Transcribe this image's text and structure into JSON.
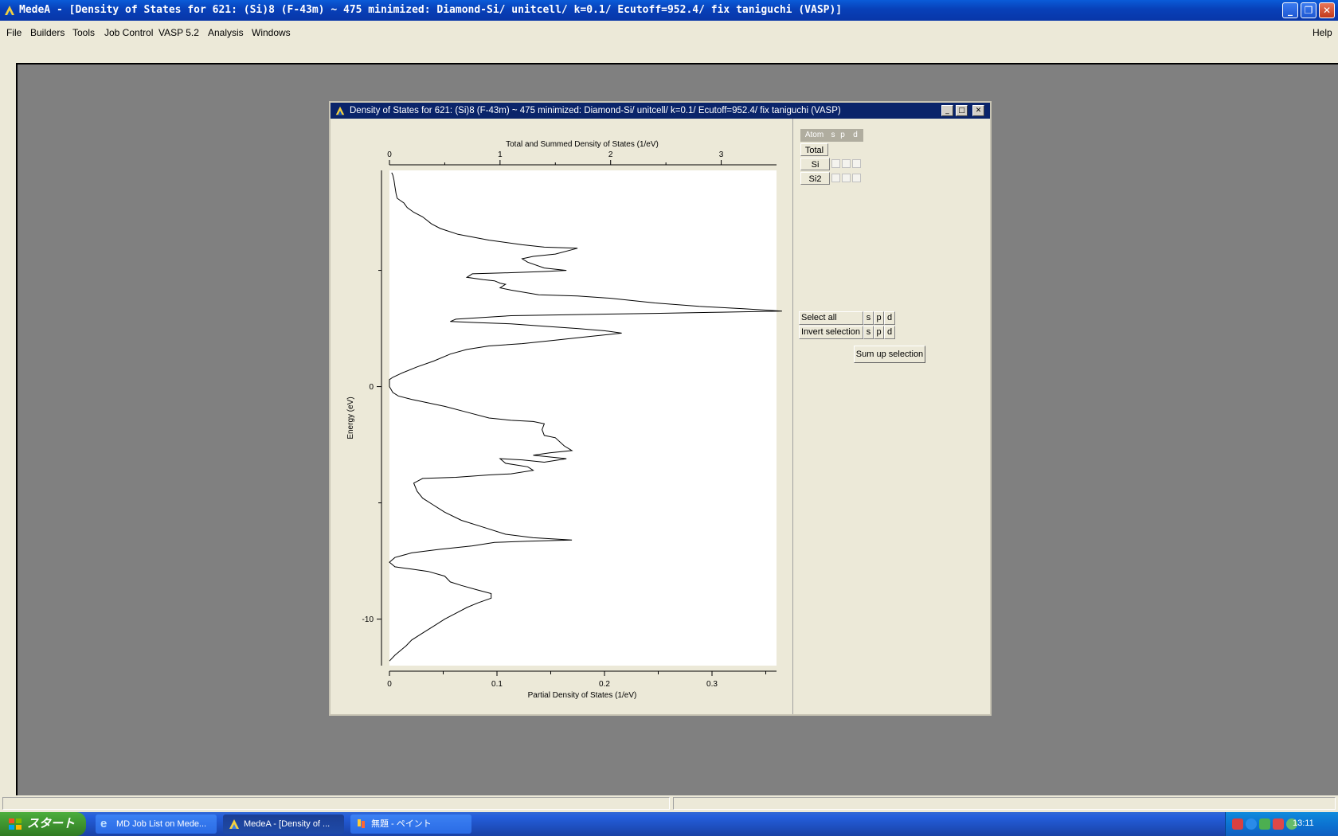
{
  "window": {
    "title": "MedeA - [Density of States for 621: (Si)8  (F-43m) ~ 475 minimized: Diamond-Si/ unitcell/ k=0.1/ Ecutoff=952.4/ fix taniguchi (VASP)]"
  },
  "menu": {
    "items": [
      "File",
      "Builders",
      "Tools",
      "Job Control",
      "VASP 5.2",
      "Analysis",
      "Windows"
    ],
    "help": "Help"
  },
  "child": {
    "title": "Density of States for 621: (Si)8  (F-43m) ~ 475 minimized: Diamond-Si/ unitcell/ k=0.1/ Ecutoff=952.4/ fix taniguchi (VASP)"
  },
  "chart_data": {
    "type": "line",
    "orientation": "vertical-energy",
    "title": "Total and Summed Density of States (1/eV)",
    "xlabel": "Partial Density of States (1/eV)",
    "ylabel": "Energy (eV)",
    "top_axis": {
      "ticks": [
        0,
        1,
        2,
        3
      ],
      "range": [
        0,
        3.5
      ]
    },
    "bottom_axis": {
      "ticks": [
        0,
        0.1,
        0.2,
        0.3
      ],
      "range": [
        0,
        0.36
      ]
    },
    "y_ticks": [
      0,
      -10
    ],
    "ylim": [
      -12,
      9.3
    ],
    "series": [
      {
        "points": [
          [
            0.02,
            9.2
          ],
          [
            0.03,
            9.1
          ],
          [
            0.04,
            8.9
          ],
          [
            0.05,
            8.6
          ],
          [
            0.06,
            8.3
          ],
          [
            0.07,
            8.1
          ],
          [
            0.1,
            8.0
          ],
          [
            0.13,
            7.9
          ],
          [
            0.16,
            7.7
          ],
          [
            0.22,
            7.5
          ],
          [
            0.3,
            7.3
          ],
          [
            0.38,
            7.0
          ],
          [
            0.46,
            6.8
          ],
          [
            0.62,
            6.55
          ],
          [
            0.9,
            6.3
          ],
          [
            1.2,
            6.1
          ],
          [
            1.4,
            6.0
          ],
          [
            1.7,
            5.95
          ],
          [
            1.5,
            5.7
          ],
          [
            1.3,
            5.6
          ],
          [
            1.2,
            5.5
          ],
          [
            1.25,
            5.35
          ],
          [
            1.4,
            5.1
          ],
          [
            1.6,
            5.0
          ],
          [
            1.4,
            4.95
          ],
          [
            1.1,
            4.9
          ],
          [
            0.75,
            4.85
          ],
          [
            0.7,
            4.7
          ],
          [
            0.85,
            4.6
          ],
          [
            0.95,
            4.55
          ],
          [
            1.0,
            4.45
          ],
          [
            1.05,
            4.4
          ],
          [
            1.0,
            4.25
          ],
          [
            1.1,
            4.15
          ],
          [
            1.35,
            3.95
          ],
          [
            1.7,
            3.9
          ],
          [
            2.0,
            3.8
          ],
          [
            2.4,
            3.6
          ],
          [
            2.8,
            3.45
          ],
          [
            3.2,
            3.35
          ],
          [
            3.55,
            3.25
          ],
          [
            3.0,
            3.2
          ],
          [
            2.4,
            3.15
          ],
          [
            1.7,
            3.1
          ],
          [
            1.1,
            3.05
          ],
          [
            0.6,
            2.9
          ],
          [
            0.55,
            2.8
          ],
          [
            0.8,
            2.75
          ],
          [
            1.1,
            2.7
          ],
          [
            1.4,
            2.6
          ],
          [
            1.7,
            2.5
          ],
          [
            1.95,
            2.4
          ],
          [
            2.1,
            2.3
          ],
          [
            1.8,
            2.15
          ],
          [
            1.5,
            2.0
          ],
          [
            1.2,
            1.85
          ],
          [
            0.9,
            1.75
          ],
          [
            0.7,
            1.6
          ],
          [
            0.55,
            1.4
          ],
          [
            0.4,
            1.1
          ],
          [
            0.25,
            0.85
          ],
          [
            0.12,
            0.6
          ],
          [
            0.03,
            0.4
          ],
          [
            0.0,
            0.3
          ],
          [
            0.0,
            0.0
          ],
          [
            0.03,
            -0.25
          ],
          [
            0.08,
            -0.4
          ],
          [
            0.2,
            -0.55
          ],
          [
            0.35,
            -0.7
          ],
          [
            0.5,
            -0.85
          ],
          [
            0.7,
            -1.1
          ],
          [
            0.9,
            -1.35
          ],
          [
            1.1,
            -1.45
          ],
          [
            1.3,
            -1.5
          ],
          [
            1.4,
            -1.6
          ],
          [
            1.38,
            -1.85
          ],
          [
            1.4,
            -2.1
          ],
          [
            1.5,
            -2.2
          ],
          [
            1.58,
            -2.55
          ],
          [
            1.65,
            -2.75
          ],
          [
            1.45,
            -2.85
          ],
          [
            1.3,
            -2.95
          ],
          [
            1.6,
            -3.1
          ],
          [
            1.4,
            -3.25
          ],
          [
            1.2,
            -3.15
          ],
          [
            1.0,
            -3.1
          ],
          [
            1.05,
            -3.3
          ],
          [
            1.25,
            -3.45
          ],
          [
            1.3,
            -3.6
          ],
          [
            1.1,
            -3.75
          ],
          [
            0.9,
            -3.8
          ],
          [
            0.6,
            -3.9
          ],
          [
            0.3,
            -3.95
          ],
          [
            0.22,
            -4.15
          ],
          [
            0.25,
            -4.5
          ],
          [
            0.3,
            -4.8
          ],
          [
            0.4,
            -5.1
          ],
          [
            0.5,
            -5.4
          ],
          [
            0.65,
            -5.75
          ],
          [
            0.85,
            -6.05
          ],
          [
            1.05,
            -6.35
          ],
          [
            1.3,
            -6.5
          ],
          [
            1.65,
            -6.6
          ],
          [
            1.25,
            -6.65
          ],
          [
            0.95,
            -6.7
          ],
          [
            0.75,
            -6.85
          ],
          [
            0.45,
            -7.0
          ],
          [
            0.2,
            -7.15
          ],
          [
            0.05,
            -7.35
          ],
          [
            0.0,
            -7.55
          ],
          [
            0.05,
            -7.75
          ],
          [
            0.2,
            -7.85
          ],
          [
            0.35,
            -7.95
          ],
          [
            0.5,
            -8.15
          ],
          [
            0.55,
            -8.4
          ],
          [
            0.65,
            -8.55
          ],
          [
            0.8,
            -8.75
          ],
          [
            0.92,
            -8.9
          ],
          [
            0.92,
            -9.1
          ],
          [
            0.8,
            -9.3
          ],
          [
            0.7,
            -9.5
          ],
          [
            0.6,
            -9.75
          ],
          [
            0.5,
            -10.0
          ],
          [
            0.4,
            -10.3
          ],
          [
            0.3,
            -10.6
          ],
          [
            0.2,
            -10.9
          ],
          [
            0.15,
            -11.15
          ],
          [
            0.1,
            -11.35
          ],
          [
            0.05,
            -11.55
          ],
          [
            0.0,
            -11.8
          ]
        ]
      }
    ]
  },
  "panel": {
    "header": [
      "Atom",
      "s",
      "p",
      "d"
    ],
    "rows": [
      "Total",
      "Si",
      "Si2"
    ],
    "select_all": "Select all",
    "invert_selection": "Invert selection",
    "orbital_labels": [
      "s",
      "p",
      "d"
    ],
    "sum_button": "Sum up selection"
  },
  "taskbar": {
    "start": "スタート",
    "tasks": [
      "MD Job List on Mede...",
      "MedeA - [Density of ...",
      "無題 - ペイント"
    ],
    "clock": "13:11"
  }
}
